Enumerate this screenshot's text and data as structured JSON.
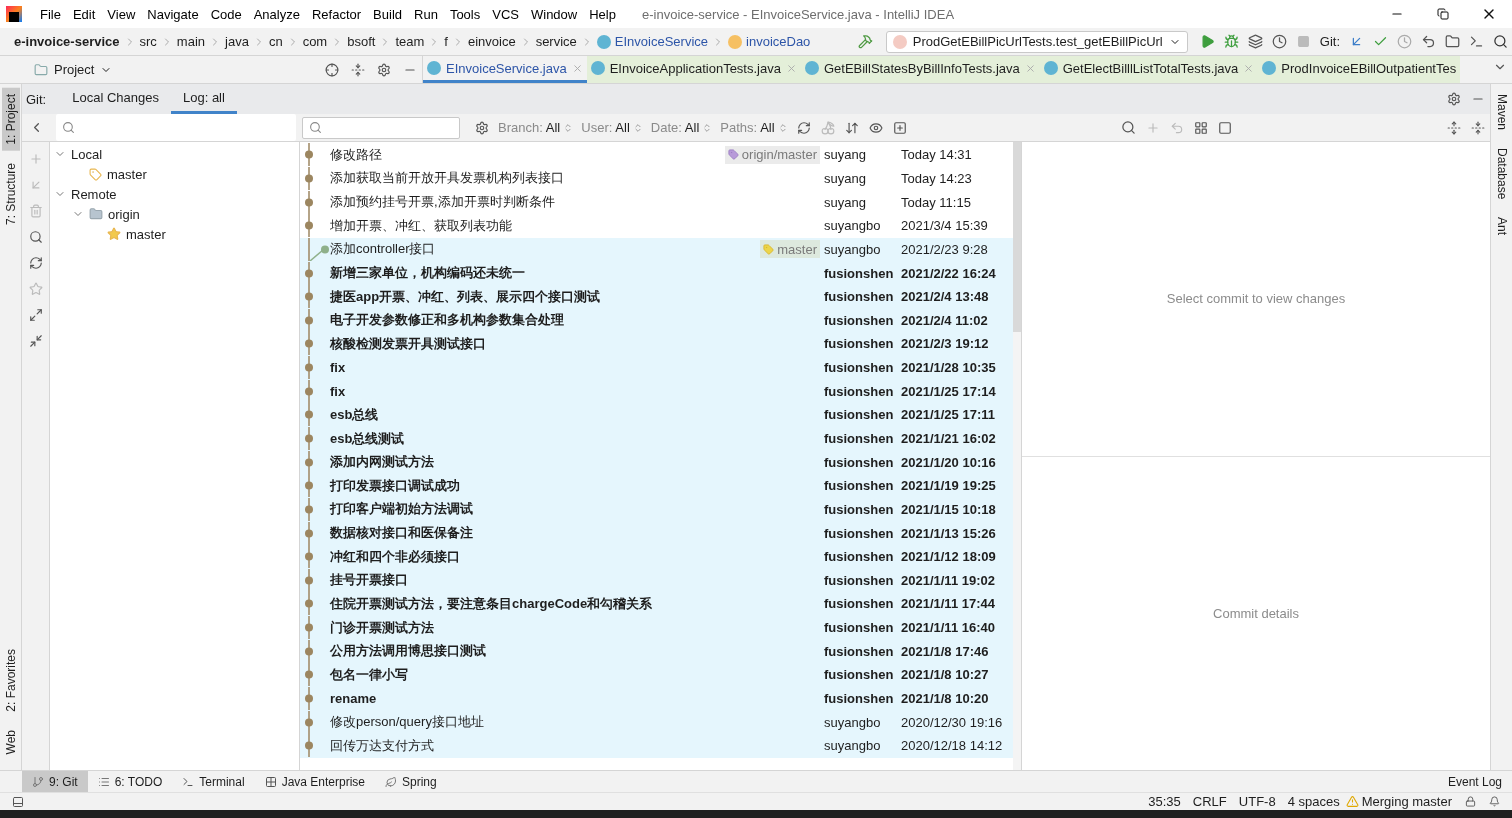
{
  "window": {
    "title": "e-invoice-service - EInvoiceService.java - IntelliJ IDEA"
  },
  "menu": [
    "File",
    "Edit",
    "View",
    "Navigate",
    "Code",
    "Analyze",
    "Refactor",
    "Build",
    "Run",
    "Tools",
    "VCS",
    "Window",
    "Help"
  ],
  "breadcrumbs": [
    {
      "label": "e-invoice-service",
      "kind": "project"
    },
    {
      "label": "src",
      "kind": "folder"
    },
    {
      "label": "main",
      "kind": "folder"
    },
    {
      "label": "java",
      "kind": "folder"
    },
    {
      "label": "cn",
      "kind": "folder"
    },
    {
      "label": "com",
      "kind": "folder"
    },
    {
      "label": "bsoft",
      "kind": "folder"
    },
    {
      "label": "team",
      "kind": "folder"
    },
    {
      "label": "f",
      "kind": "folder"
    },
    {
      "label": "einvoice",
      "kind": "folder"
    },
    {
      "label": "service",
      "kind": "folder"
    },
    {
      "label": "EInvoiceService",
      "kind": "class"
    },
    {
      "label": "invoiceDao",
      "kind": "field"
    }
  ],
  "run_config": "ProdGetEBillPicUrlTests.test_getEBillPicUrl",
  "toolbar_git_label": "Git:",
  "project_tool": {
    "label": "Project"
  },
  "editor_tabs": [
    {
      "label": "EInvoiceService.java",
      "selected": true,
      "closable": true
    },
    {
      "label": "EInvoiceApplicationTests.java",
      "selected": false,
      "closable": true
    },
    {
      "label": "GetEBillStatesByBillInfoTests.java",
      "selected": false,
      "closable": true
    },
    {
      "label": "GetElectBilllListTotalTests.java",
      "selected": false,
      "closable": true
    },
    {
      "label": "ProdInvoiceEBillOutpatientTes",
      "selected": false,
      "closable": false
    }
  ],
  "left_stripe": {
    "top": [
      {
        "label": "1: Project",
        "selected": true
      },
      {
        "label": "7: Structure",
        "selected": false
      }
    ],
    "bottom": [
      {
        "label": "2: Favorites",
        "selected": false
      },
      {
        "label": "Web",
        "selected": false
      }
    ]
  },
  "right_stripe": [
    "Maven",
    "Database",
    "Ant"
  ],
  "git": {
    "label": "Git:",
    "tabs": [
      {
        "label": "Local Changes",
        "selected": false
      },
      {
        "label": "Log: all",
        "selected": true
      }
    ],
    "filters": [
      {
        "label": "Branch:",
        "value": "All"
      },
      {
        "label": "User:",
        "value": "All"
      },
      {
        "label": "Date:",
        "value": "All"
      },
      {
        "label": "Paths:",
        "value": "All"
      }
    ],
    "branches": [
      {
        "label": "Local",
        "expanded": true,
        "children": [
          {
            "label": "master",
            "kind": "branch"
          }
        ]
      },
      {
        "label": "Remote",
        "expanded": true,
        "children": [
          {
            "label": "origin",
            "kind": "folder",
            "expanded": true,
            "children": [
              {
                "label": "master",
                "kind": "favorite"
              }
            ]
          }
        ]
      }
    ],
    "commits": [
      {
        "message": "修改路径",
        "author": "suyang",
        "date": "Today 14:31",
        "bold": false,
        "highlighted": false,
        "side_lane": false,
        "ref": {
          "label": "origin/master",
          "kind": "remote"
        }
      },
      {
        "message": "添加获取当前开放开具发票机构列表接口",
        "author": "suyang",
        "date": "Today 14:23",
        "bold": false,
        "highlighted": false,
        "side_lane": false
      },
      {
        "message": "添加预约挂号开票,添加开票时判断条件",
        "author": "suyang",
        "date": "Today 11:15",
        "bold": false,
        "highlighted": false,
        "side_lane": false
      },
      {
        "message": "增加开票、冲红、获取列表功能",
        "author": "suyangbo",
        "date": "2021/3/4 15:39",
        "bold": false,
        "highlighted": false,
        "side_lane": false
      },
      {
        "message": "添加controller接口",
        "author": "suyangbo",
        "date": "2021/2/23 9:28",
        "bold": false,
        "highlighted": true,
        "side_lane": true,
        "ref": {
          "label": "master",
          "kind": "local"
        }
      },
      {
        "message": "新增三家单位，机构编码还未统一",
        "author": "fusionshen",
        "date": "2021/2/22 16:24",
        "bold": true,
        "highlighted": true,
        "side_lane": false
      },
      {
        "message": "捷医app开票、冲红、列表、展示四个接口测试",
        "author": "fusionshen",
        "date": "2021/2/4 13:48",
        "bold": true,
        "highlighted": true,
        "side_lane": false
      },
      {
        "message": "电子开发参数修正和多机构参数集合处理",
        "author": "fusionshen",
        "date": "2021/2/4 11:02",
        "bold": true,
        "highlighted": true,
        "side_lane": false
      },
      {
        "message": "核酸检测发票开具测试接口",
        "author": "fusionshen",
        "date": "2021/2/3 19:12",
        "bold": true,
        "highlighted": true,
        "side_lane": false
      },
      {
        "message": "fix",
        "author": "fusionshen",
        "date": "2021/1/28 10:35",
        "bold": true,
        "highlighted": true,
        "side_lane": false
      },
      {
        "message": "fix",
        "author": "fusionshen",
        "date": "2021/1/25 17:14",
        "bold": true,
        "highlighted": true,
        "side_lane": false
      },
      {
        "message": "esb总线",
        "author": "fusionshen",
        "date": "2021/1/25 17:11",
        "bold": true,
        "highlighted": true,
        "side_lane": false
      },
      {
        "message": "esb总线测试",
        "author": "fusionshen",
        "date": "2021/1/21 16:02",
        "bold": true,
        "highlighted": true,
        "side_lane": false
      },
      {
        "message": "添加内网测试方法",
        "author": "fusionshen",
        "date": "2021/1/20 10:16",
        "bold": true,
        "highlighted": true,
        "side_lane": false
      },
      {
        "message": "打印发票接口调试成功",
        "author": "fusionshen",
        "date": "2021/1/19 19:25",
        "bold": true,
        "highlighted": true,
        "side_lane": false
      },
      {
        "message": "打印客户端初始方法调试",
        "author": "fusionshen",
        "date": "2021/1/15 10:18",
        "bold": true,
        "highlighted": true,
        "side_lane": false
      },
      {
        "message": "数据核对接口和医保备注",
        "author": "fusionshen",
        "date": "2021/1/13 15:26",
        "bold": true,
        "highlighted": true,
        "side_lane": false
      },
      {
        "message": "冲红和四个非必须接口",
        "author": "fusionshen",
        "date": "2021/1/12 18:09",
        "bold": true,
        "highlighted": true,
        "side_lane": false
      },
      {
        "message": "挂号开票接口",
        "author": "fusionshen",
        "date": "2021/1/11 19:02",
        "bold": true,
        "highlighted": true,
        "side_lane": false
      },
      {
        "message": "住院开票测试方法，要注意条目chargeCode和勾稽关系",
        "author": "fusionshen",
        "date": "2021/1/11 17:44",
        "bold": true,
        "highlighted": true,
        "side_lane": false
      },
      {
        "message": "门诊开票测试方法",
        "author": "fusionshen",
        "date": "2021/1/11 16:40",
        "bold": true,
        "highlighted": true,
        "side_lane": false
      },
      {
        "message": "公用方法调用博思接口测试",
        "author": "fusionshen",
        "date": "2021/1/8 17:46",
        "bold": true,
        "highlighted": true,
        "side_lane": false
      },
      {
        "message": "包名一律小写",
        "author": "fusionshen",
        "date": "2021/1/8 10:27",
        "bold": true,
        "highlighted": true,
        "side_lane": false
      },
      {
        "message": "rename",
        "author": "fusionshen",
        "date": "2021/1/8 10:20",
        "bold": true,
        "highlighted": true,
        "side_lane": false
      },
      {
        "message": "修改person/query接口地址",
        "author": "suyangbo",
        "date": "2020/12/30 19:16",
        "bold": false,
        "highlighted": true,
        "side_lane": false
      },
      {
        "message": "回传万达支付方式",
        "author": "suyangbo",
        "date": "2020/12/18 14:12",
        "bold": false,
        "highlighted": true,
        "side_lane": false
      }
    ],
    "details": {
      "changes_hint": "Select commit to view changes",
      "details_hint": "Commit details"
    }
  },
  "tool_windows": [
    {
      "label": "9: Git",
      "selected": true,
      "kind": "git"
    },
    {
      "label": "6: TODO",
      "selected": false,
      "kind": "todo"
    },
    {
      "label": "Terminal",
      "selected": false,
      "kind": "terminal"
    },
    {
      "label": "Java Enterprise",
      "selected": false,
      "kind": "enterprise"
    },
    {
      "label": "Spring",
      "selected": false,
      "kind": "spring"
    }
  ],
  "event_log": "Event Log",
  "status_bar": [
    "35:35",
    "CRLF",
    "UTF-8",
    "4 spaces"
  ],
  "vcs_status": "Merging master"
}
